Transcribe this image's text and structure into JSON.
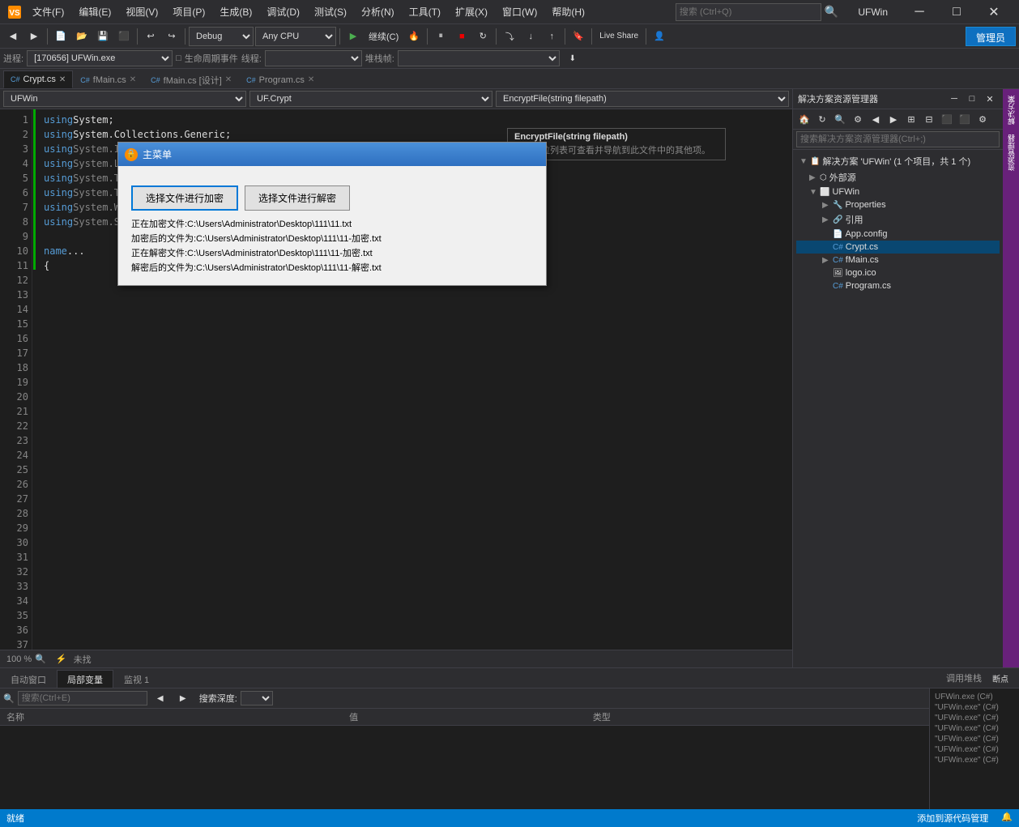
{
  "titlebar": {
    "icon": "VS",
    "menus": [
      "文件(F)",
      "编辑(E)",
      "视图(V)",
      "项目(P)",
      "生成(B)",
      "调试(D)",
      "测试(S)",
      "分析(N)",
      "工具(T)",
      "扩展(X)",
      "窗口(W)",
      "帮助(H)"
    ],
    "search_placeholder": "搜索 (Ctrl+Q)",
    "title": "UFWin",
    "controls": [
      "─",
      "□",
      "✕"
    ]
  },
  "toolbar": {
    "debug_label": "Debug",
    "cpu_label": "Any CPU",
    "continue_label": "继续(C)",
    "live_share": "Live Share",
    "admin_label": "管理员"
  },
  "process_bar": {
    "label_process": "进程:",
    "process_value": "[170656] UFWin.exe",
    "label_lifecycle": "生命周期事件",
    "label_thread": "线程:",
    "thread_value": "",
    "label_stack": "堆栈帧:",
    "stack_value": ""
  },
  "tabs": [
    {
      "label": "Crypt.cs",
      "active": true
    },
    {
      "label": "fMain.cs",
      "active": false
    },
    {
      "label": "fMain.cs [设计]",
      "active": false
    },
    {
      "label": "Program.cs",
      "active": false
    }
  ],
  "editor": {
    "class_dropdown": "UFWin",
    "method_dropdown": "UF.Crypt",
    "function_dropdown": "EncryptFile(string filepath)",
    "hint_title": "EncryptFile(string filepath)",
    "hint_desc": "使用下拉列表可查看并导航到此文件中的其他项。",
    "code_lines": [
      {
        "num": 1,
        "text": "using System;"
      },
      {
        "num": 2,
        "text": "using System.Collections.Generic;"
      },
      {
        "num": 3,
        "text": "using System.IO;"
      },
      {
        "num": 4,
        "text": "using System.Linq;"
      },
      {
        "num": 5,
        "text": "using System.Text;"
      },
      {
        "num": 6,
        "text": "using System.Threading.Tasks;"
      },
      {
        "num": 7,
        "text": "using System.Windows.Forms;"
      },
      {
        "num": 8,
        "text": "using System.Security.Cryptography;"
      },
      {
        "num": 9,
        "text": ""
      },
      {
        "num": 10,
        "text": "namespace UFWin"
      },
      {
        "num": 11,
        "text": "{"
      },
      {
        "num": 12,
        "text": ""
      },
      {
        "num": 13,
        "text": ""
      },
      {
        "num": 14,
        "text": ""
      },
      {
        "num": 15,
        "text": ""
      },
      {
        "num": 16,
        "text": ""
      },
      {
        "num": 17,
        "text": ""
      },
      {
        "num": 18,
        "text": ""
      },
      {
        "num": 19,
        "text": ""
      },
      {
        "num": 20,
        "text": ""
      },
      {
        "num": 21,
        "text": ""
      },
      {
        "num": 22,
        "text": ""
      },
      {
        "num": 23,
        "text": ""
      },
      {
        "num": 24,
        "text": ""
      },
      {
        "num": 25,
        "text": ""
      },
      {
        "num": 26,
        "text": ""
      },
      {
        "num": 27,
        "text": ""
      },
      {
        "num": 28,
        "text": ""
      },
      {
        "num": 29,
        "text": ""
      },
      {
        "num": 30,
        "text": ""
      },
      {
        "num": 31,
        "text": ""
      },
      {
        "num": 32,
        "text": ""
      },
      {
        "num": 33,
        "text": ""
      },
      {
        "num": 34,
        "text": ""
      },
      {
        "num": 35,
        "text": ""
      },
      {
        "num": 36,
        "text": ""
      },
      {
        "num": 37,
        "text": ""
      }
    ]
  },
  "dialog": {
    "title": "主菜单",
    "btn_encrypt": "选择文件进行加密",
    "btn_decrypt": "选择文件进行解密",
    "output": [
      "正在加密文件:C:\\Users\\Administrator\\Desktop\\111\\11.txt",
      "加密后的文件为:C:\\Users\\Administrator\\Desktop\\111\\11-加密.txt",
      "正在解密文件:C:\\Users\\Administrator\\Desktop\\111\\11-加密.txt",
      "解密后的文件为:C:\\Users\\Administrator\\Desktop\\111\\11-解密.txt"
    ]
  },
  "solution_explorer": {
    "title": "解决方案资源管理器",
    "search_placeholder": "搜索解决方案资源管理器(Ctrl+;)",
    "tree_title": "解决方案 'UFWin' (1 个项目，共 1 个)",
    "items": [
      {
        "label": "UFWin",
        "level": 1
      },
      {
        "label": "外部源",
        "level": 2
      },
      {
        "label": "UFWin",
        "level": 2
      },
      {
        "label": "Properties",
        "level": 3
      },
      {
        "label": "引用",
        "level": 3
      },
      {
        "label": "App.config",
        "level": 3
      },
      {
        "label": "Crypt.cs",
        "level": 3,
        "active": true
      },
      {
        "label": "fMain.cs",
        "level": 3
      },
      {
        "label": "logo.ico",
        "level": 3
      },
      {
        "label": "Program.cs",
        "level": 3
      }
    ]
  },
  "bottom": {
    "tabs": [
      "自动窗口",
      "局部变量",
      "监视 1"
    ],
    "active_tab": "局部变量",
    "search_placeholder": "搜索(Ctrl+E)",
    "columns": [
      "名称",
      "值",
      "类型"
    ],
    "call_stack": {
      "label": "调用堆栈",
      "items": [
        "UFWin.exe (C#)",
        "\"UFWin.exe\" (C#)",
        "\"UFWin.exe\" (C#)",
        "\"UFWin.exe\" (C#)",
        "\"UFWin.exe\" (C#)",
        "\"UFWin.exe\" (C#)",
        "\"UFWin.exe\" (C#)"
      ]
    },
    "breakpoints_label": "断点",
    "right_btn": "添加到源代码管理"
  },
  "status_bar": {
    "ready": "就绪",
    "right_items": [
      "添加到源代码管理",
      "🔔"
    ]
  },
  "right_strip": {
    "items": [
      "解",
      "决",
      "方",
      "案",
      "资",
      "源",
      "管",
      "理",
      "器"
    ]
  }
}
